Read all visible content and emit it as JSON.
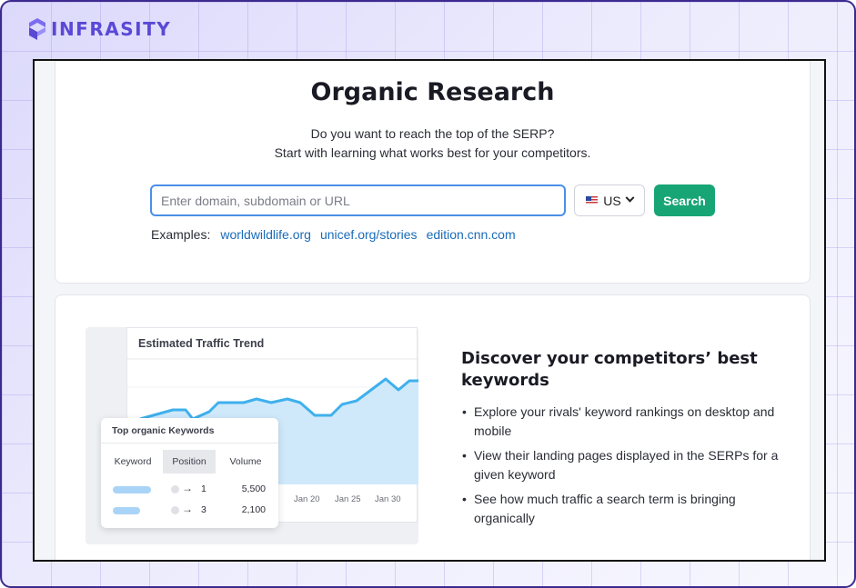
{
  "brand": {
    "name": "INFRASITY",
    "color": "#5a49d6"
  },
  "search_section": {
    "title": "Organic Research",
    "subtitle_line1": "Do you want to reach the top of the SERP?",
    "subtitle_line2": "Start with learning what works best for your competitors.",
    "input_placeholder": "Enter domain, subdomain or URL",
    "input_value": "",
    "database": {
      "flag": "us-flag-icon",
      "label": "US"
    },
    "search_button": "Search",
    "examples_label": "Examples:",
    "examples": [
      "worldwildlife.org",
      "unicef.org/stories",
      "edition.cnn.com"
    ]
  },
  "illustration": {
    "chart_title": "Estimated Traffic Trend",
    "x_ticks": [
      "Jan 20",
      "Jan 25",
      "Jan 30"
    ],
    "table_title": "Top organic Keywords",
    "columns": [
      "Keyword",
      "Position",
      "Volume"
    ],
    "rows": [
      {
        "position": "1",
        "volume": "5,500"
      },
      {
        "position": "3",
        "volume": "2,100"
      }
    ]
  },
  "feature": {
    "title": "Discover your competitors’ best keywords",
    "bullets": [
      "Explore your rivals' keyword rankings on desktop and mobile",
      "View their landing pages displayed in the SERPs for a given keyword",
      "See how much traffic a search term is bringing organically"
    ]
  },
  "colors": {
    "accent_green": "#18a575",
    "link_blue": "#1a6bb8",
    "input_focus": "#4a8fe8",
    "chart_line": "#3fb0ec",
    "chart_fill": "#cfe9fb"
  }
}
